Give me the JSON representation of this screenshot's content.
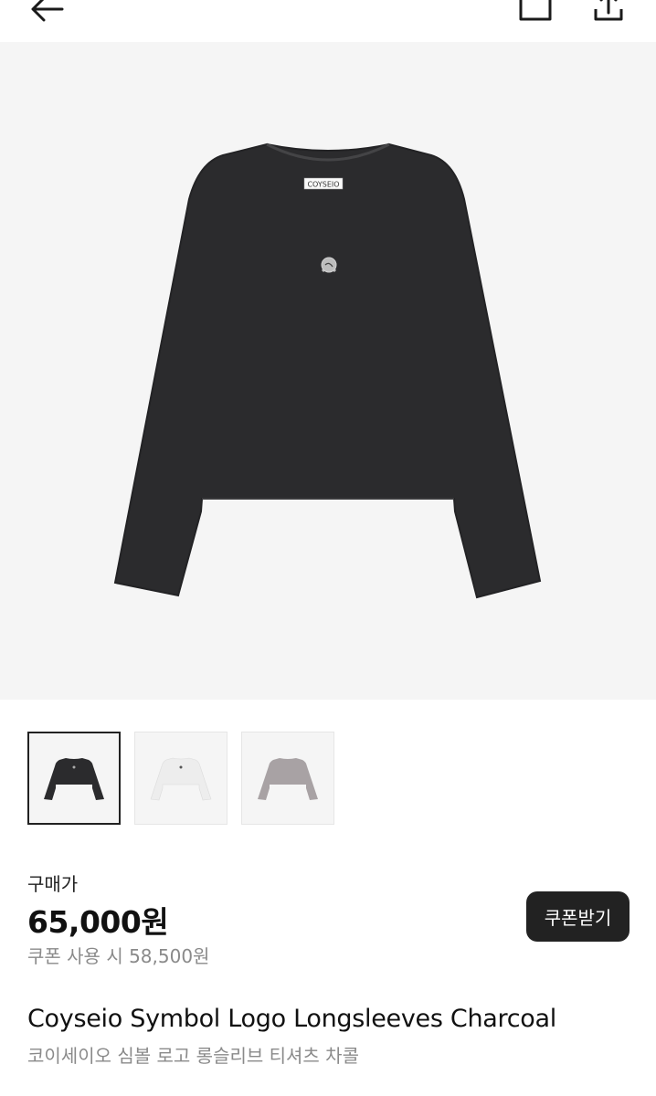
{
  "header": {
    "back_icon": "arrow-left-icon",
    "cart_icon": "shopping-bag-icon",
    "share_icon": "share-icon"
  },
  "product": {
    "image_tag_text": "COYSEIO",
    "colors": [
      "#2b2b2d",
      "#ededed",
      "#a8a2a4"
    ],
    "selected_thumbnail": 0
  },
  "pricing": {
    "label": "구매가",
    "price": "65,000원",
    "coupon_price": "쿠폰 사용 시 58,500원",
    "coupon_button": "쿠폰받기"
  },
  "title": {
    "english": "Coyseio Symbol Logo Longsleeves Charcoal",
    "korean": "코이세이오 심볼 로고 롱슬리브 티셔츠 차콜"
  }
}
